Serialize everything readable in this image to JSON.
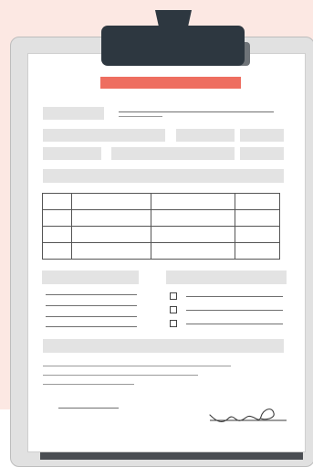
{
  "illustration": {
    "subject": "clipboard-with-blank-form",
    "colors": {
      "background": "#fce8e3",
      "clip": "#2d3740",
      "accent": "#ee6e60",
      "placeholder": "#e3e3e3",
      "board": "#e1e1e1"
    },
    "table": {
      "rows": 4,
      "columns": 4
    },
    "checklist": {
      "items": 3
    }
  }
}
